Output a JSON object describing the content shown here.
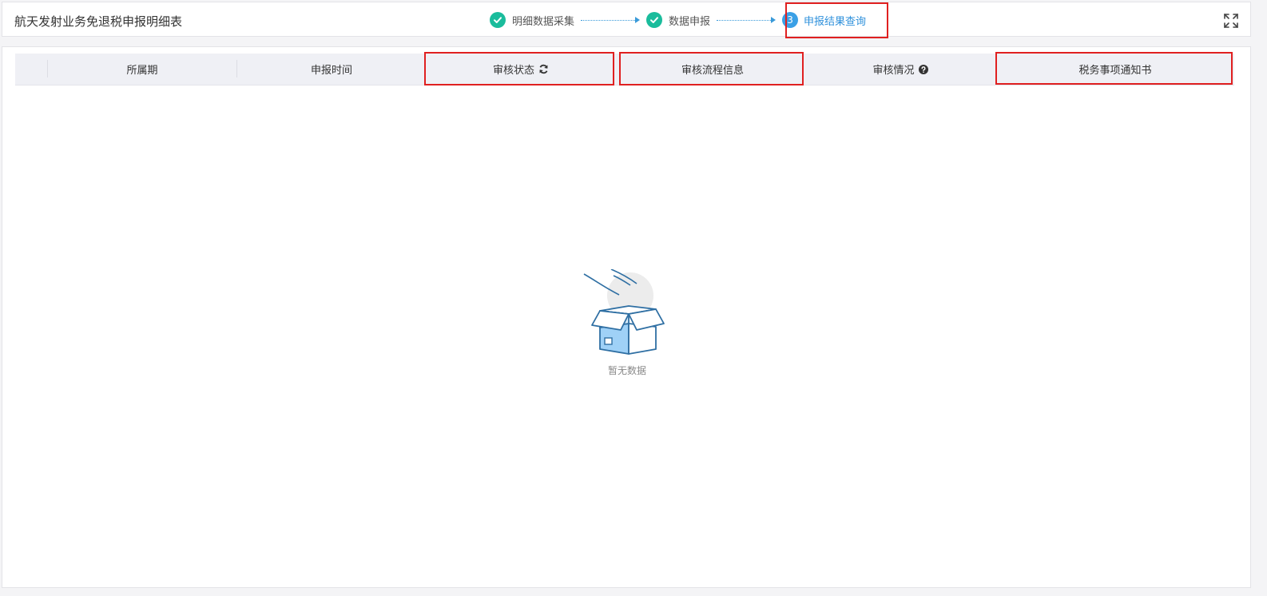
{
  "header": {
    "title": "航天发射业务免退税申报明细表"
  },
  "steps": [
    {
      "label": "明细数据采集",
      "state": "done"
    },
    {
      "label": "数据申报",
      "state": "done"
    },
    {
      "label": "申报结果查询",
      "state": "active",
      "number": "3"
    }
  ],
  "table": {
    "columns": [
      "所属期",
      "申报时间",
      "审核状态",
      "审核流程信息",
      "审核情况",
      "税务事项通知书"
    ],
    "rows": []
  },
  "empty_state": {
    "text": "暂无数据"
  },
  "colors": {
    "accent": "#2e90db",
    "step_done": "#1abc9c",
    "highlight": "#e02020",
    "header_bg": "#eff0f5"
  },
  "icons": {
    "step_done": "check-circle-icon",
    "fullscreen": "expand-icon",
    "refresh": "refresh-icon",
    "help": "question-circle-icon",
    "empty": "empty-box-icon"
  }
}
